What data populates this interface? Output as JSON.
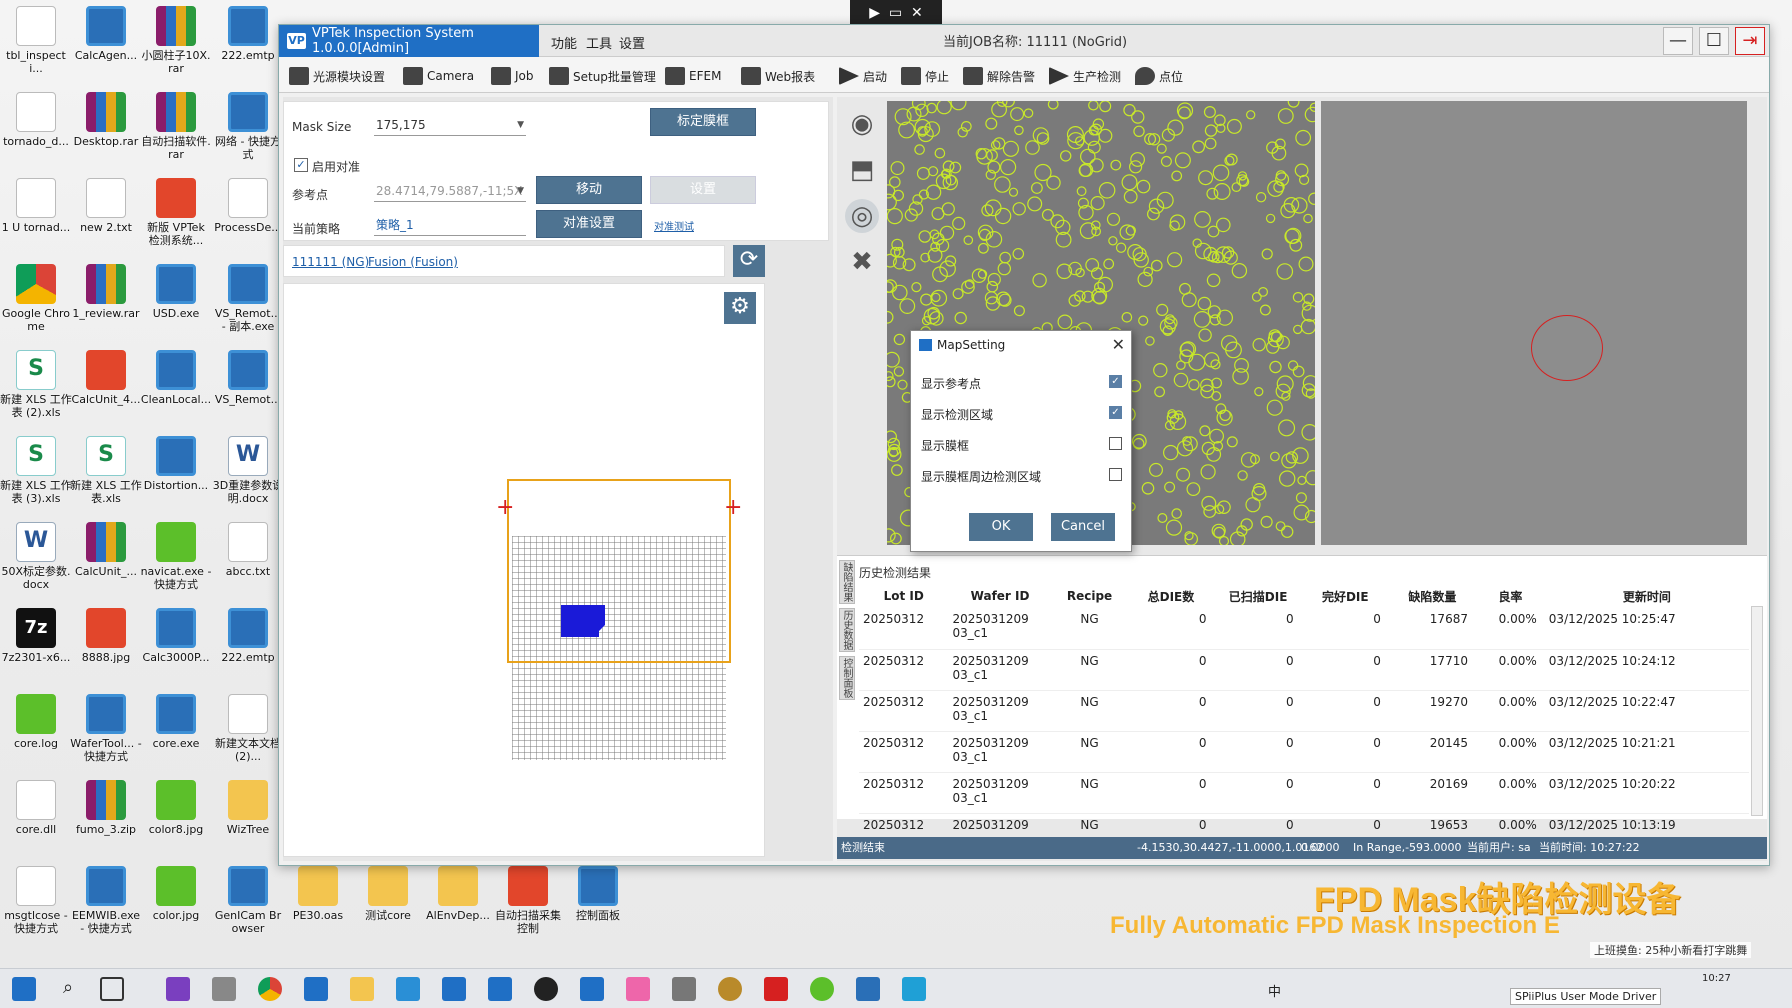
{
  "desktop": {
    "icons": [
      {
        "label": "tbl_inspecti...",
        "kind": "doc"
      },
      {
        "label": "CalcAgen...",
        "kind": "exe"
      },
      {
        "label": "小圆柱子10X.rar",
        "kind": "rar"
      },
      {
        "label": "222.emtp",
        "kind": "exe"
      },
      {
        "label": "tornado_d...",
        "kind": "doc"
      },
      {
        "label": "Desktop.rar",
        "kind": "rar"
      },
      {
        "label": "自动扫描软件.rar",
        "kind": "rar"
      },
      {
        "label": "网络 - 快捷方式",
        "kind": "exe"
      },
      {
        "label": "1 U tornad...",
        "kind": "doc"
      },
      {
        "label": "new 2.txt",
        "kind": "doc"
      },
      {
        "label": "新版 VPTek 检测系统...",
        "kind": "red"
      },
      {
        "label": "ProcessDe...",
        "kind": "doc"
      },
      {
        "label": "Google Chrome",
        "kind": "chrome"
      },
      {
        "label": "1_review.rar",
        "kind": "rar"
      },
      {
        "label": "USD.exe",
        "kind": "exe"
      },
      {
        "label": "VS_Remot... - 副本.exe",
        "kind": "exe"
      },
      {
        "label": "新建 XLS 工作表 (2).xls",
        "kind": "xls"
      },
      {
        "label": "CalcUnit_4...",
        "kind": "red"
      },
      {
        "label": "CleanLocal...",
        "kind": "exe"
      },
      {
        "label": "VS_Remot...",
        "kind": "exe"
      },
      {
        "label": "新建 XLS 工作表 (3).xls",
        "kind": "xls"
      },
      {
        "label": "新建 XLS 工作表.xls",
        "kind": "xls"
      },
      {
        "label": "Distortion...",
        "kind": "exe"
      },
      {
        "label": "3D重建参数说明.docx",
        "kind": "word"
      },
      {
        "label": "50X标定参数.docx",
        "kind": "word"
      },
      {
        "label": "CalcUnit_...",
        "kind": "rar"
      },
      {
        "label": "navicat.exe - 快捷方式",
        "kind": "green"
      },
      {
        "label": "abcc.txt",
        "kind": "doc"
      },
      {
        "label": "7z2301-x6...",
        "kind": "7z"
      },
      {
        "label": "8888.jpg",
        "kind": "red"
      },
      {
        "label": "Calc3000P...",
        "kind": "exe"
      },
      {
        "label": "222.emtp",
        "kind": "exe"
      },
      {
        "label": "core.log",
        "kind": "green"
      },
      {
        "label": "WaferTool... - 快捷方式",
        "kind": "exe"
      },
      {
        "label": "core.exe",
        "kind": "exe"
      },
      {
        "label": "新建文本文档 (2)...",
        "kind": "doc"
      },
      {
        "label": "core.dll",
        "kind": "doc"
      },
      {
        "label": "fumo_3.zip",
        "kind": "rar"
      },
      {
        "label": "color8.jpg",
        "kind": "green"
      },
      {
        "label": "WizTree",
        "kind": "folder"
      },
      {
        "label": "msgtlcose - 快捷方式",
        "kind": "doc"
      },
      {
        "label": "EEMWIB.exe - 快捷方式",
        "kind": "exe"
      },
      {
        "label": "color.jpg",
        "kind": "green"
      },
      {
        "label": "GenICam Browser",
        "kind": "exe"
      },
      {
        "label": "PE30.oas",
        "kind": "folder"
      },
      {
        "label": "测试core",
        "kind": "folder"
      },
      {
        "label": "AlEnvDep...",
        "kind": "folder"
      },
      {
        "label": "自动扫描采集控制",
        "kind": "red"
      },
      {
        "label": "控制面板",
        "kind": "exe"
      }
    ]
  },
  "window": {
    "app_title": "VPTek Inspection System 1.0.0.0[Admin]",
    "logo": "VP",
    "menus": [
      "功能",
      "工具",
      "设置"
    ],
    "job_name": "当前JOB名称: 11111 (NoGrid)",
    "controls": {
      "minimize": "—",
      "maximize": "☐",
      "close": "⇥"
    }
  },
  "toolbar": [
    {
      "label": "光源模块设置",
      "icon": "light-icon"
    },
    {
      "label": "Camera",
      "icon": "camera-icon"
    },
    {
      "label": "Job",
      "icon": "briefcase-icon"
    },
    {
      "label": "Setup批量管理",
      "icon": "list-icon"
    },
    {
      "label": "EFEM",
      "icon": "robot-arm-icon"
    },
    {
      "label": "Web报表",
      "icon": "monitor-icon"
    },
    {
      "label": "启动",
      "icon": "play-icon"
    },
    {
      "label": "停止",
      "icon": "stop-icon"
    },
    {
      "label": "解除告警",
      "icon": "bell-off-icon"
    },
    {
      "label": "生产检测",
      "icon": "play-icon"
    },
    {
      "label": "点位",
      "icon": "location-icon"
    }
  ],
  "settings": {
    "mask_size_label": "Mask Size",
    "mask_size_value": "175,175",
    "calibrate_button": "标定膜框",
    "enable_align_label": "启用对准",
    "enable_align_checked": true,
    "ref_point_label": "参考点",
    "ref_point_value": "28.4714,79.5887,-11;5X",
    "move_button": "移动",
    "set_button": "设置",
    "strategy_label": "当前策略",
    "strategy_value": "策略_1",
    "align_settings_button": "对准设置",
    "align_test_link": "对准测试"
  },
  "links": {
    "job_link": "111111 (NG)",
    "fusion_link": "Fusion (Fusion)"
  },
  "map_dialog": {
    "title": "MapSetting",
    "options": [
      {
        "label": "显示参考点",
        "checked": true
      },
      {
        "label": "显示检测区域",
        "checked": true
      },
      {
        "label": "显示膜框",
        "checked": false
      },
      {
        "label": "显示膜框周边检测区域",
        "checked": false
      }
    ],
    "ok": "OK",
    "cancel": "Cancel"
  },
  "history": {
    "title": "历史检测结果",
    "side_tabs": [
      "缺陷结果",
      "历史数据",
      "控制面板"
    ],
    "columns": [
      "Lot ID",
      "Wafer ID",
      "Recipe",
      "总DIE数",
      "已扫描DIE",
      "完好DIE",
      "缺陷数量",
      "良率",
      "更新时间"
    ],
    "rows": [
      [
        "20250312",
        "2025031209\n03_c1",
        "NG",
        "0",
        "0",
        "0",
        "17687",
        "0.00%",
        "03/12/2025 10:25:47"
      ],
      [
        "20250312",
        "2025031209\n03_c1",
        "NG",
        "0",
        "0",
        "0",
        "17710",
        "0.00%",
        "03/12/2025 10:24:12"
      ],
      [
        "20250312",
        "2025031209\n03_c1",
        "NG",
        "0",
        "0",
        "0",
        "19270",
        "0.00%",
        "03/12/2025 10:22:47"
      ],
      [
        "20250312",
        "2025031209\n03_c1",
        "NG",
        "0",
        "0",
        "0",
        "20145",
        "0.00%",
        "03/12/2025 10:21:21"
      ],
      [
        "20250312",
        "2025031209\n03_c1",
        "NG",
        "0",
        "0",
        "0",
        "20169",
        "0.00%",
        "03/12/2025 10:20:22"
      ],
      [
        "20250312",
        "2025031209",
        "NG",
        "0",
        "0",
        "0",
        "19653",
        "0.00%",
        "03/12/2025 10:13:19"
      ]
    ]
  },
  "status": {
    "left": "检测结束",
    "coords": "-4.1530,30.4427,-11.0000,1.0162",
    "value": "0.0000",
    "range": "In Range,-593.0000",
    "user": "当前用户: sa",
    "time": "当前时间: 10:27:22"
  },
  "banner": {
    "line1": "FPD Mask缺陷检测设备",
    "line2": "Fully Automatic FPD Mask Inspection E"
  },
  "taskbar": {
    "tray_text": "SPiiPlus User Mode Driver",
    "ime": "中",
    "clock": "10:27"
  },
  "overlay_text": "上班摸鱼: 25种小新看打字跳舞"
}
